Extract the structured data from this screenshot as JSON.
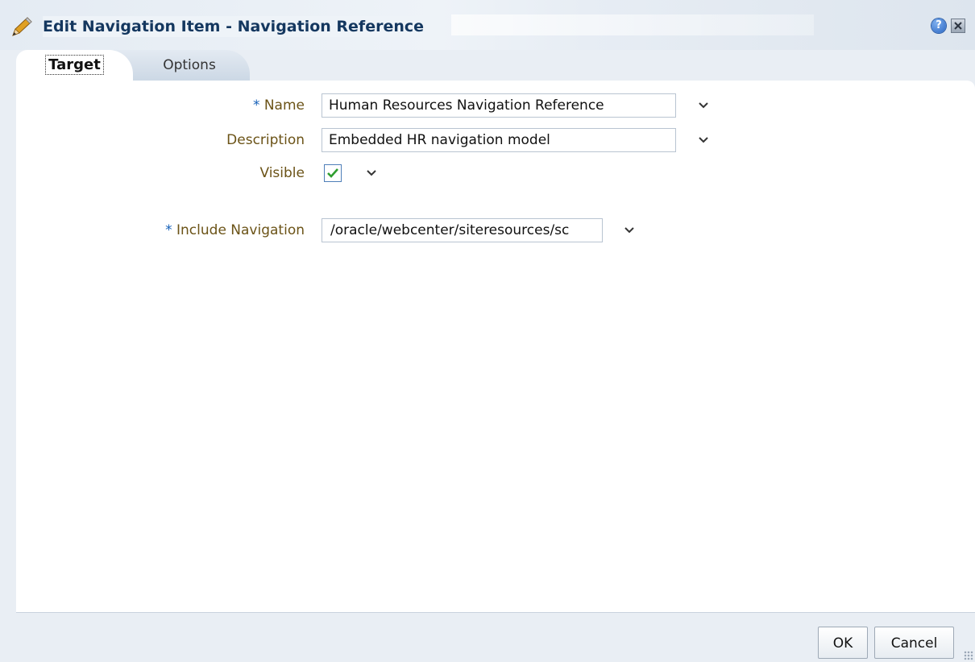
{
  "dialog": {
    "title": "Edit Navigation Item - Navigation Reference",
    "help_symbol": "?",
    "icons": {
      "title": "pencil-icon",
      "help": "help-icon",
      "close": "close-icon"
    }
  },
  "tabs": [
    {
      "label": "Target",
      "selected": true
    },
    {
      "label": "Options",
      "selected": false
    }
  ],
  "form": {
    "required_marker": "*",
    "name": {
      "label": "Name",
      "value": "Human Resources Navigation Reference",
      "required": true
    },
    "description": {
      "label": "Description",
      "value": "Embedded HR navigation model",
      "required": false
    },
    "visible": {
      "label": "Visible",
      "checked": true
    },
    "include_navigation": {
      "label": "Include Navigation",
      "value": "/oracle/webcenter/siteresources/sc",
      "required": true
    }
  },
  "buttons": {
    "ok": "OK",
    "cancel": "Cancel"
  },
  "colors": {
    "title_text": "#14375f",
    "label_text": "#6b5317",
    "required_marker": "#1560b8",
    "check_mark": "#2f9e2f",
    "background": "#e9eef4"
  }
}
